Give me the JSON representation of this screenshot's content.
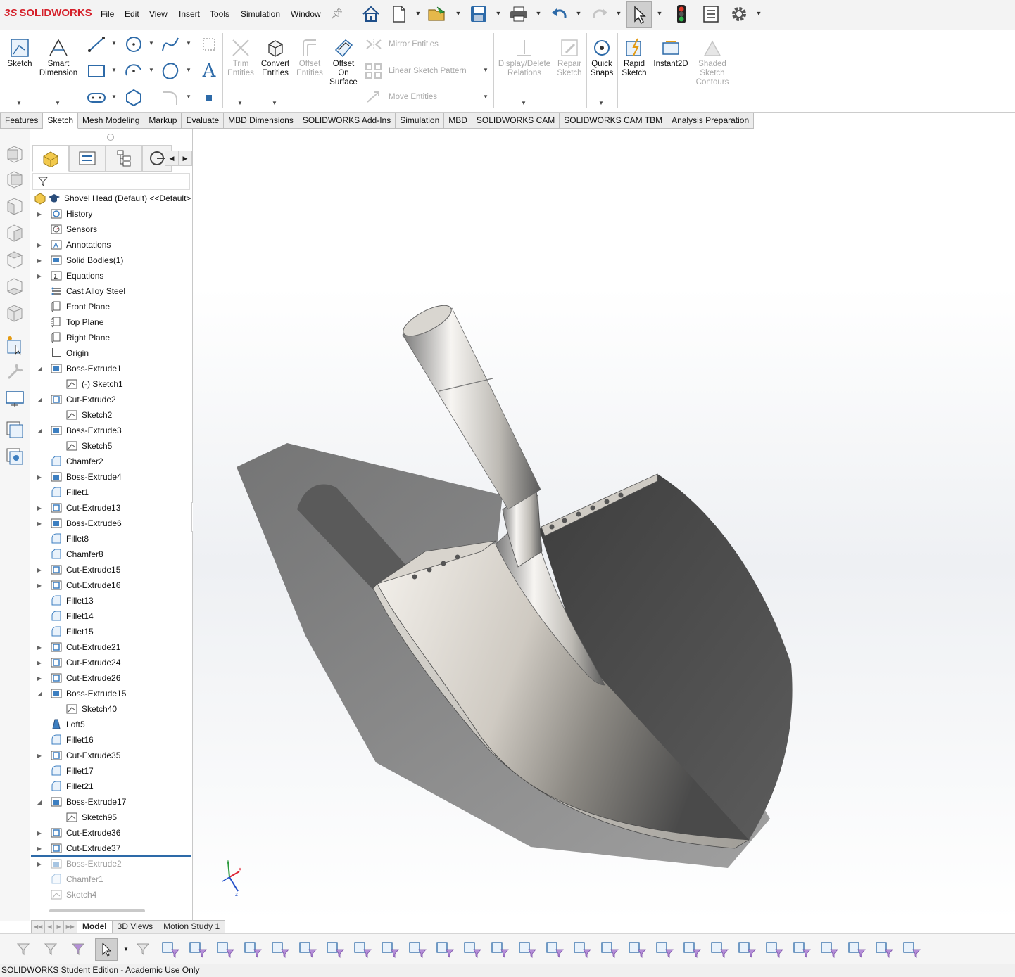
{
  "app": {
    "logo_text": "SOLIDWORKS",
    "logo_prefix": "3S"
  },
  "menu": [
    "File",
    "Edit",
    "View",
    "Insert",
    "Tools",
    "Simulation",
    "Window"
  ],
  "ribbon": {
    "sketch": "Sketch",
    "smart_dimension": "Smart Dimension",
    "trim_entities": "Trim Entities",
    "convert_entities": "Convert Entities",
    "offset_entities": "Offset Entities",
    "offset_on_surface": "Offset On Surface",
    "mirror_entities": "Mirror Entities",
    "linear_sketch_pattern": "Linear Sketch Pattern",
    "move_entities": "Move Entities",
    "display_delete_relations": "Display/Delete Relations",
    "repair_sketch": "Repair Sketch",
    "quick_snaps": "Quick Snaps",
    "rapid_sketch": "Rapid Sketch",
    "instant2d": "Instant2D",
    "shaded_sketch_contours": "Shaded Sketch Contours"
  },
  "tabs": [
    "Features",
    "Sketch",
    "Mesh Modeling",
    "Markup",
    "Evaluate",
    "MBD Dimensions",
    "SOLIDWORKS Add-Ins",
    "Simulation",
    "MBD",
    "SOLIDWORKS CAM",
    "SOLIDWORKS CAM TBM",
    "Analysis Preparation"
  ],
  "active_tab": "Sketch",
  "tree": {
    "root": "Shovel Head (Default) <<Default>",
    "items": [
      {
        "label": "History",
        "icon": "history-icon",
        "expand": "collapsed",
        "indent": 0
      },
      {
        "label": "Sensors",
        "icon": "sensor-icon",
        "expand": "none",
        "indent": 0
      },
      {
        "label": "Annotations",
        "icon": "annotation-icon",
        "expand": "collapsed",
        "indent": 0
      },
      {
        "label": "Solid Bodies(1)",
        "icon": "solid-bodies-icon",
        "expand": "collapsed",
        "indent": 0
      },
      {
        "label": "Equations",
        "icon": "equations-icon",
        "expand": "collapsed",
        "indent": 0
      },
      {
        "label": "Cast Alloy Steel",
        "icon": "material-icon",
        "expand": "none",
        "indent": 0
      },
      {
        "label": "Front Plane",
        "icon": "plane-icon",
        "expand": "none",
        "indent": 0
      },
      {
        "label": "Top Plane",
        "icon": "plane-icon",
        "expand": "none",
        "indent": 0
      },
      {
        "label": "Right Plane",
        "icon": "plane-icon",
        "expand": "none",
        "indent": 0
      },
      {
        "label": "Origin",
        "icon": "origin-icon",
        "expand": "none",
        "indent": 0
      },
      {
        "label": "Boss-Extrude1",
        "icon": "boss-extrude-icon",
        "expand": "expanded",
        "indent": 0
      },
      {
        "label": "(-) Sketch1",
        "icon": "sketch-icon",
        "expand": "none",
        "indent": 1
      },
      {
        "label": "Cut-Extrude2",
        "icon": "cut-extrude-icon",
        "expand": "expanded",
        "indent": 0
      },
      {
        "label": "Sketch2",
        "icon": "sketch-icon",
        "expand": "none",
        "indent": 1
      },
      {
        "label": "Boss-Extrude3",
        "icon": "boss-extrude-icon",
        "expand": "expanded",
        "indent": 0
      },
      {
        "label": "Sketch5",
        "icon": "sketch-icon",
        "expand": "none",
        "indent": 1
      },
      {
        "label": "Chamfer2",
        "icon": "chamfer-icon",
        "expand": "none",
        "indent": 0
      },
      {
        "label": "Boss-Extrude4",
        "icon": "boss-extrude-icon",
        "expand": "collapsed",
        "indent": 0
      },
      {
        "label": "Fillet1",
        "icon": "fillet-icon",
        "expand": "none",
        "indent": 0
      },
      {
        "label": "Cut-Extrude13",
        "icon": "cut-extrude-icon",
        "expand": "collapsed",
        "indent": 0
      },
      {
        "label": "Boss-Extrude6",
        "icon": "boss-extrude-icon",
        "expand": "collapsed",
        "indent": 0
      },
      {
        "label": "Fillet8",
        "icon": "fillet-icon",
        "expand": "none",
        "indent": 0
      },
      {
        "label": "Chamfer8",
        "icon": "chamfer-icon",
        "expand": "none",
        "indent": 0
      },
      {
        "label": "Cut-Extrude15",
        "icon": "cut-extrude-icon",
        "expand": "collapsed",
        "indent": 0
      },
      {
        "label": "Cut-Extrude16",
        "icon": "cut-extrude-icon",
        "expand": "collapsed",
        "indent": 0
      },
      {
        "label": "Fillet13",
        "icon": "fillet-icon",
        "expand": "none",
        "indent": 0
      },
      {
        "label": "Fillet14",
        "icon": "fillet-icon",
        "expand": "none",
        "indent": 0
      },
      {
        "label": "Fillet15",
        "icon": "fillet-icon",
        "expand": "none",
        "indent": 0
      },
      {
        "label": "Cut-Extrude21",
        "icon": "cut-extrude-icon",
        "expand": "collapsed",
        "indent": 0
      },
      {
        "label": "Cut-Extrude24",
        "icon": "cut-extrude-icon",
        "expand": "collapsed",
        "indent": 0
      },
      {
        "label": "Cut-Extrude26",
        "icon": "cut-extrude-icon",
        "expand": "collapsed",
        "indent": 0
      },
      {
        "label": "Boss-Extrude15",
        "icon": "boss-extrude-icon",
        "expand": "expanded",
        "indent": 0
      },
      {
        "label": "Sketch40",
        "icon": "sketch-icon",
        "expand": "none",
        "indent": 1
      },
      {
        "label": "Loft5",
        "icon": "loft-icon",
        "expand": "none",
        "indent": 0
      },
      {
        "label": "Fillet16",
        "icon": "fillet-icon",
        "expand": "none",
        "indent": 0
      },
      {
        "label": "Cut-Extrude35",
        "icon": "cut-extrude-icon",
        "expand": "collapsed",
        "indent": 0
      },
      {
        "label": "Fillet17",
        "icon": "fillet-icon",
        "expand": "none",
        "indent": 0
      },
      {
        "label": "Fillet21",
        "icon": "fillet-icon",
        "expand": "none",
        "indent": 0
      },
      {
        "label": "Boss-Extrude17",
        "icon": "boss-extrude-icon",
        "expand": "expanded",
        "indent": 0
      },
      {
        "label": "Sketch95",
        "icon": "sketch-icon",
        "expand": "none",
        "indent": 1
      },
      {
        "label": "Cut-Extrude36",
        "icon": "cut-extrude-icon",
        "expand": "collapsed",
        "indent": 0
      },
      {
        "label": "Cut-Extrude37",
        "icon": "cut-extrude-icon",
        "expand": "collapsed",
        "indent": 0
      }
    ],
    "suppressed": [
      {
        "label": "Boss-Extrude2",
        "icon": "boss-extrude-icon",
        "expand": "collapsed"
      },
      {
        "label": "Chamfer1",
        "icon": "chamfer-icon",
        "expand": "none"
      },
      {
        "label": "Sketch4",
        "icon": "sketch-icon",
        "expand": "none"
      }
    ]
  },
  "bottom_tabs": [
    "Model",
    "3D Views",
    "Motion Study 1"
  ],
  "active_bottom_tab": "Model",
  "status": "SOLIDWORKS Student Edition - Academic Use Only",
  "triad": {
    "x": "x",
    "y": "y",
    "z": "z"
  },
  "colors": {
    "accent_blue": "#1f6fb5",
    "logo_red": "#d5202a",
    "tree_icon_blue": "#3d7fc1"
  }
}
